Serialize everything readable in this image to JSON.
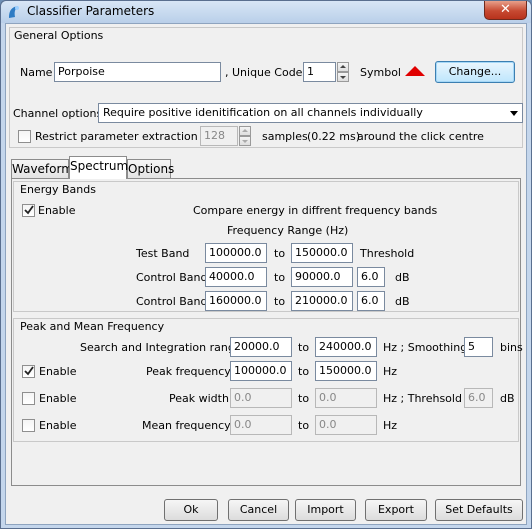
{
  "window": {
    "title": "Classifier Parameters",
    "close_label": "✕"
  },
  "general": {
    "title": "General Options",
    "name_label": "Name",
    "name_value": "Porpoise",
    "unique_code_label": ", Unique Code",
    "unique_code_value": "1",
    "symbol_label": "Symbol",
    "change_button": "Change...",
    "channel_options_label": "Channel options",
    "channel_options_value": "Require positive idenitification on all channels individually",
    "restrict_label": "Restrict parameter extraction to",
    "restrict_samples_value": "128",
    "samples_label": "samples",
    "ms_label": "(0.22 ms)",
    "around_label": "around the click centre",
    "restrict_checked": false
  },
  "tabs": [
    {
      "label": "Waveform",
      "active": false
    },
    {
      "label": "Spectrum",
      "active": true
    },
    {
      "label": "Options",
      "active": false
    }
  ],
  "energy": {
    "title": "Energy Bands",
    "enable_label": "Enable",
    "enable_checked": true,
    "description": "Compare energy in diffrent frequency bands",
    "freq_range_label": "Frequency Range (Hz)",
    "test_band_label": "Test Band",
    "test_band_from": "100000.0",
    "test_band_to": "150000.0",
    "threshold_label": "Threshold",
    "control1_label": "Control Band",
    "control1_from": "40000.0",
    "control1_to": "90000.0",
    "control1_db": "6.0",
    "control2_label": "Control Band",
    "control2_from": "160000.0",
    "control2_to": "210000.0",
    "control2_db": "6.0",
    "to_label": "to",
    "db_label": "dB"
  },
  "peak": {
    "title": "Peak and Mean Frequency",
    "search_label": "Search and Integration range",
    "search_from": "20000.0",
    "search_to": "240000.0",
    "hz_smoothing_label": "Hz ; Smoothing",
    "smoothing_value": "5",
    "bins_label": "bins",
    "peak_freq_enable_checked": true,
    "enable_label": "Enable",
    "peak_freq_label": "Peak frequency",
    "peak_freq_from": "100000.0",
    "peak_freq_to": "150000.0",
    "peak_width_enable_checked": false,
    "peak_width_label": "Peak width",
    "peak_width_from": "0.0",
    "peak_width_to": "0.0",
    "hz_threshold_label": "Hz ; Threhsold",
    "peak_width_threshold": "6.0",
    "mean_freq_enable_checked": false,
    "mean_freq_label": "Mean frequency",
    "mean_freq_from": "0.0",
    "mean_freq_to": "0.0",
    "to_label": "to",
    "hz_label": "Hz",
    "db_label": "dB"
  },
  "footer": {
    "ok": "Ok",
    "cancel": "Cancel",
    "import": "Import",
    "export": "Export",
    "set_defaults": "Set Defaults"
  },
  "colors": {
    "symbol": "#e00000",
    "accent": "#3c7fb1"
  },
  "icons": {
    "app": "pamguard-icon",
    "close": "close-icon",
    "symbol": "red-triangle-symbol"
  }
}
